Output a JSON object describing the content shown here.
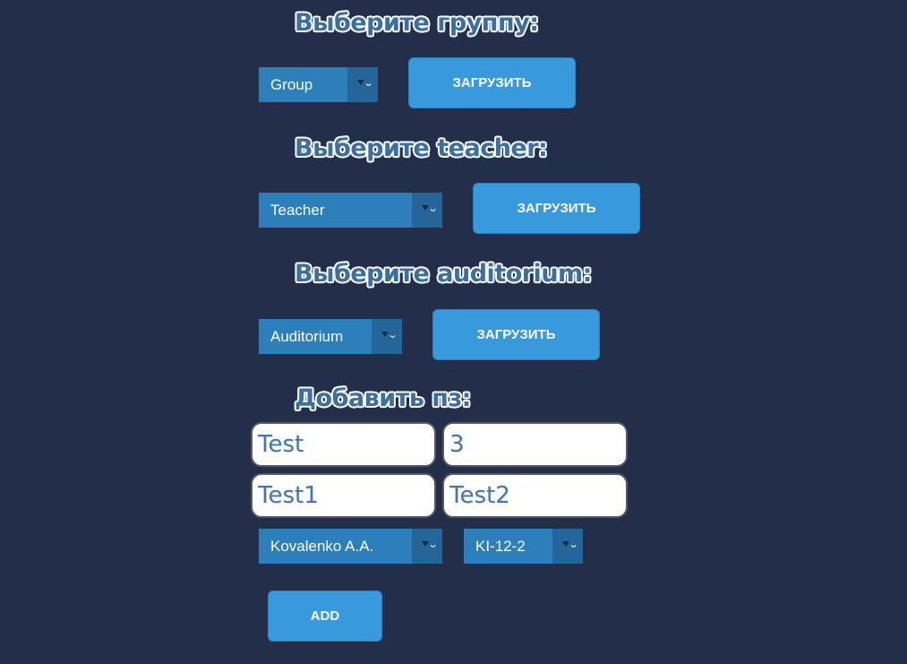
{
  "group_section": {
    "heading": "Выберите группу:",
    "select_value": "Group",
    "button_label": "ЗАГРУЗИТЬ"
  },
  "teacher_section": {
    "heading": "Выберите teacher:",
    "select_value": "Teacher",
    "button_label": "ЗАГРУЗИТЬ"
  },
  "auditorium_section": {
    "heading": "Выберите auditorium:",
    "select_value": "Auditorium",
    "button_label": "ЗАГРУЗИТЬ"
  },
  "add_section": {
    "heading": "Добавить пз:",
    "fields": [
      "Test",
      "3",
      "Test1",
      "Test2"
    ],
    "teacher_select_value": "Kovalenko A.A.",
    "group_select_value": "KI-12-2",
    "add_button_label": "ADD"
  },
  "colors": {
    "background": "#232e4a",
    "select_bg": "#2c7fba",
    "button_bg": "#3899dc",
    "heading_text": "#3d6f9e"
  },
  "icons": {
    "select_arrow": "chevron-down-icon"
  }
}
